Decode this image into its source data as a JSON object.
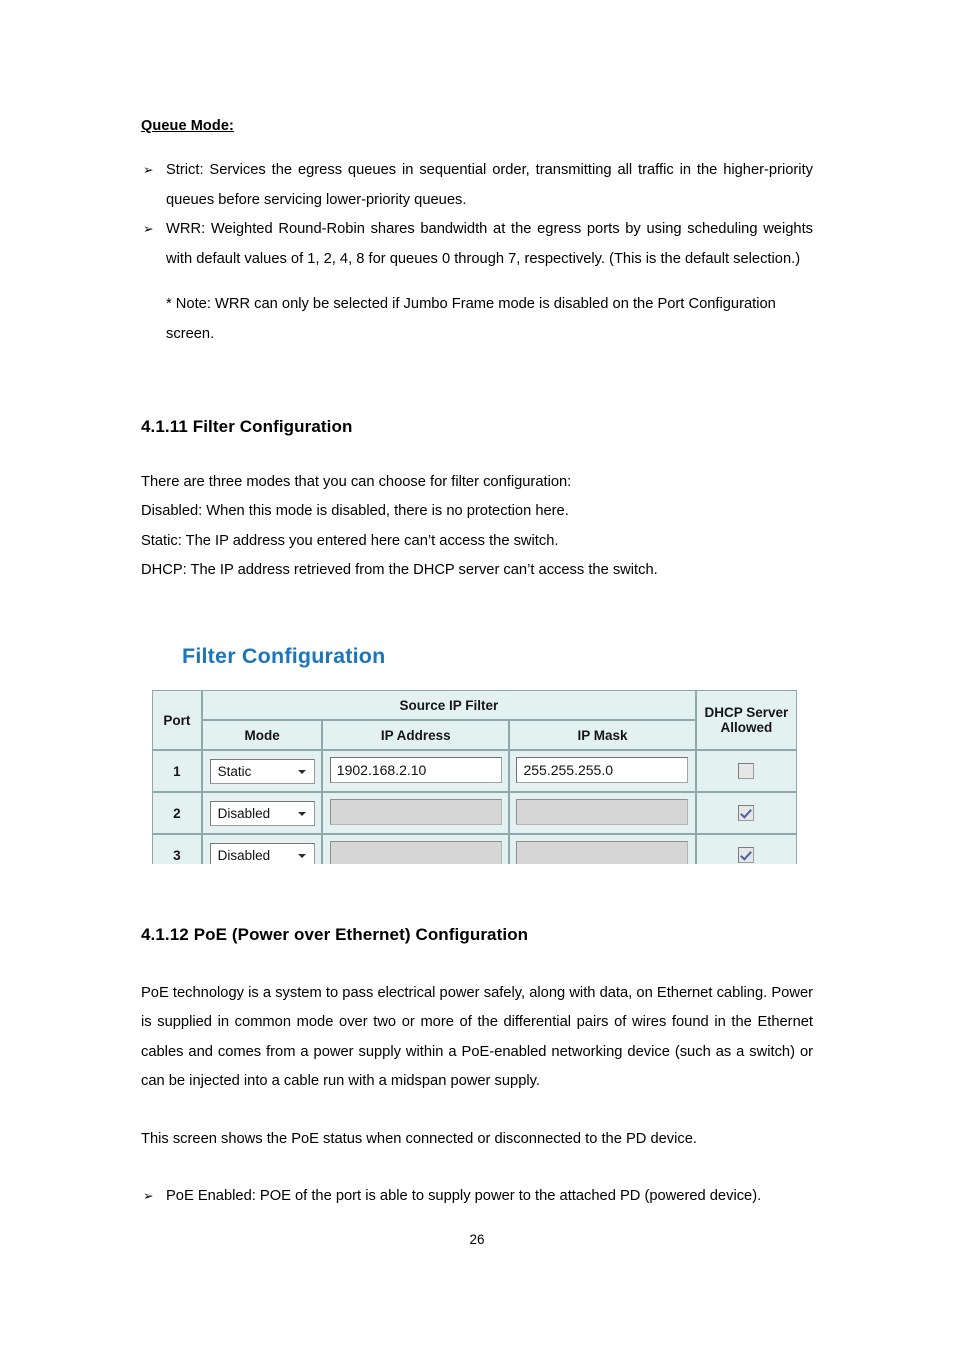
{
  "document": {
    "page_number": "26"
  },
  "queue_mode": {
    "heading": "Queue Mode:",
    "bullet_glyph": "➢",
    "items": [
      "Strict: Services the egress queues in sequential order, transmitting all traffic in the higher-priority queues before servicing lower-priority queues.",
      "WRR: Weighted Round-Robin shares bandwidth at the egress ports by using scheduling weights with default values of 1, 2, 4, 8 for queues 0 through 7, respectively. (This is the default selection.)"
    ],
    "note": "* Note: WRR can only be selected if Jumbo Frame mode is disabled on the Port Configuration screen."
  },
  "section_filter": {
    "heading": "4.1.11 Filter Configuration",
    "lines": [
      "There are three modes that you can choose for filter configuration:",
      "Disabled: When this mode is disabled, there is no protection here.",
      "Static: The IP address you entered here can’t access the switch.",
      "DHCP: The IP address retrieved from the DHCP server can’t access the switch."
    ]
  },
  "screenshot": {
    "title": "Filter Configuration",
    "title_color": "#1b76bc",
    "header_bg": "#e3f2f1",
    "headers": {
      "port": "Port",
      "source_ip_filter": "Source IP Filter",
      "mode": "Mode",
      "ip_address": "IP Address",
      "ip_mask": "IP Mask",
      "dhcp_server_allowed_line1": "DHCP Server",
      "dhcp_server_allowed_line2": "Allowed"
    },
    "rows": [
      {
        "port": "1",
        "mode": "Static",
        "ip_address": "1902.168.2.10",
        "ip_mask": "255.255.255.0",
        "ip_enabled": true,
        "dhcp_allowed": false
      },
      {
        "port": "2",
        "mode": "Disabled",
        "ip_address": "",
        "ip_mask": "",
        "ip_enabled": false,
        "dhcp_allowed": true
      },
      {
        "port": "3",
        "mode": "Disabled",
        "ip_address": "",
        "ip_mask": "",
        "ip_enabled": false,
        "dhcp_allowed": true
      }
    ]
  },
  "section_poe": {
    "heading": "4.1.12 PoE (Power over Ethernet) Configuration",
    "paragraph": "PoE technology is a system to pass electrical power safely, along with data, on Ethernet cabling. Power is supplied in common mode over two or more of the differential pairs of wires found in the Ethernet cables and comes from a power supply within a PoE-enabled networking device (such as a switch) or can be injected into a cable run with a midspan power supply.",
    "screen_note": "This screen shows the PoE status when connected or disconnected to the PD device.",
    "bullet_glyph": "➢",
    "bullets": [
      "PoE Enabled: POE of the port is able to supply power to the attached PD (powered device)."
    ]
  }
}
